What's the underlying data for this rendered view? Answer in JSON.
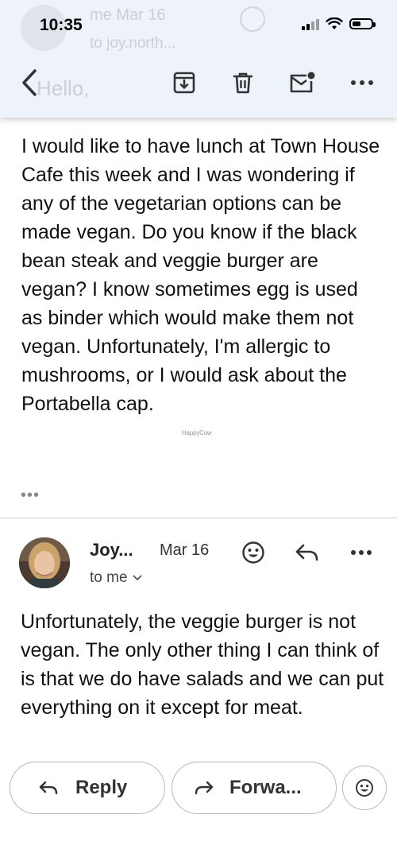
{
  "status_bar": {
    "time": "10:35"
  },
  "header": {
    "ghost_from": "me  Mar 16",
    "ghost_to": "to joy.north...",
    "ghost_greeting": "Hello,"
  },
  "toolbar": {
    "icons": [
      "back-icon",
      "archive-icon",
      "trash-icon",
      "mark-unread-icon",
      "more-icon"
    ]
  },
  "message1": {
    "body": "I would like to have lunch at Town House Cafe this week and I was wondering if any of the vegetarian options can be made vegan. Do you know if the black bean steak and veggie burger are vegan? I know sometimes egg is used as binder which would make them not vegan. Unfortunately, I'm allergic to mushrooms, or I would ask about the Portabella cap.",
    "collapsed_indicator": "•••",
    "watermark": "HappyCow"
  },
  "message2": {
    "sender": "Joy...",
    "date": "Mar 16",
    "recipient": "to me",
    "body": "Unfortunately, the veggie burger is not vegan. The only other thing I can think of is that we do have salads and we can put everything on it except for meat."
  },
  "actions": {
    "reply_label": "Reply",
    "forward_label": "Forwa..."
  },
  "colors": {
    "header_bg": "#eef2fb",
    "text": "#111111",
    "border": "#b9b9b9"
  }
}
